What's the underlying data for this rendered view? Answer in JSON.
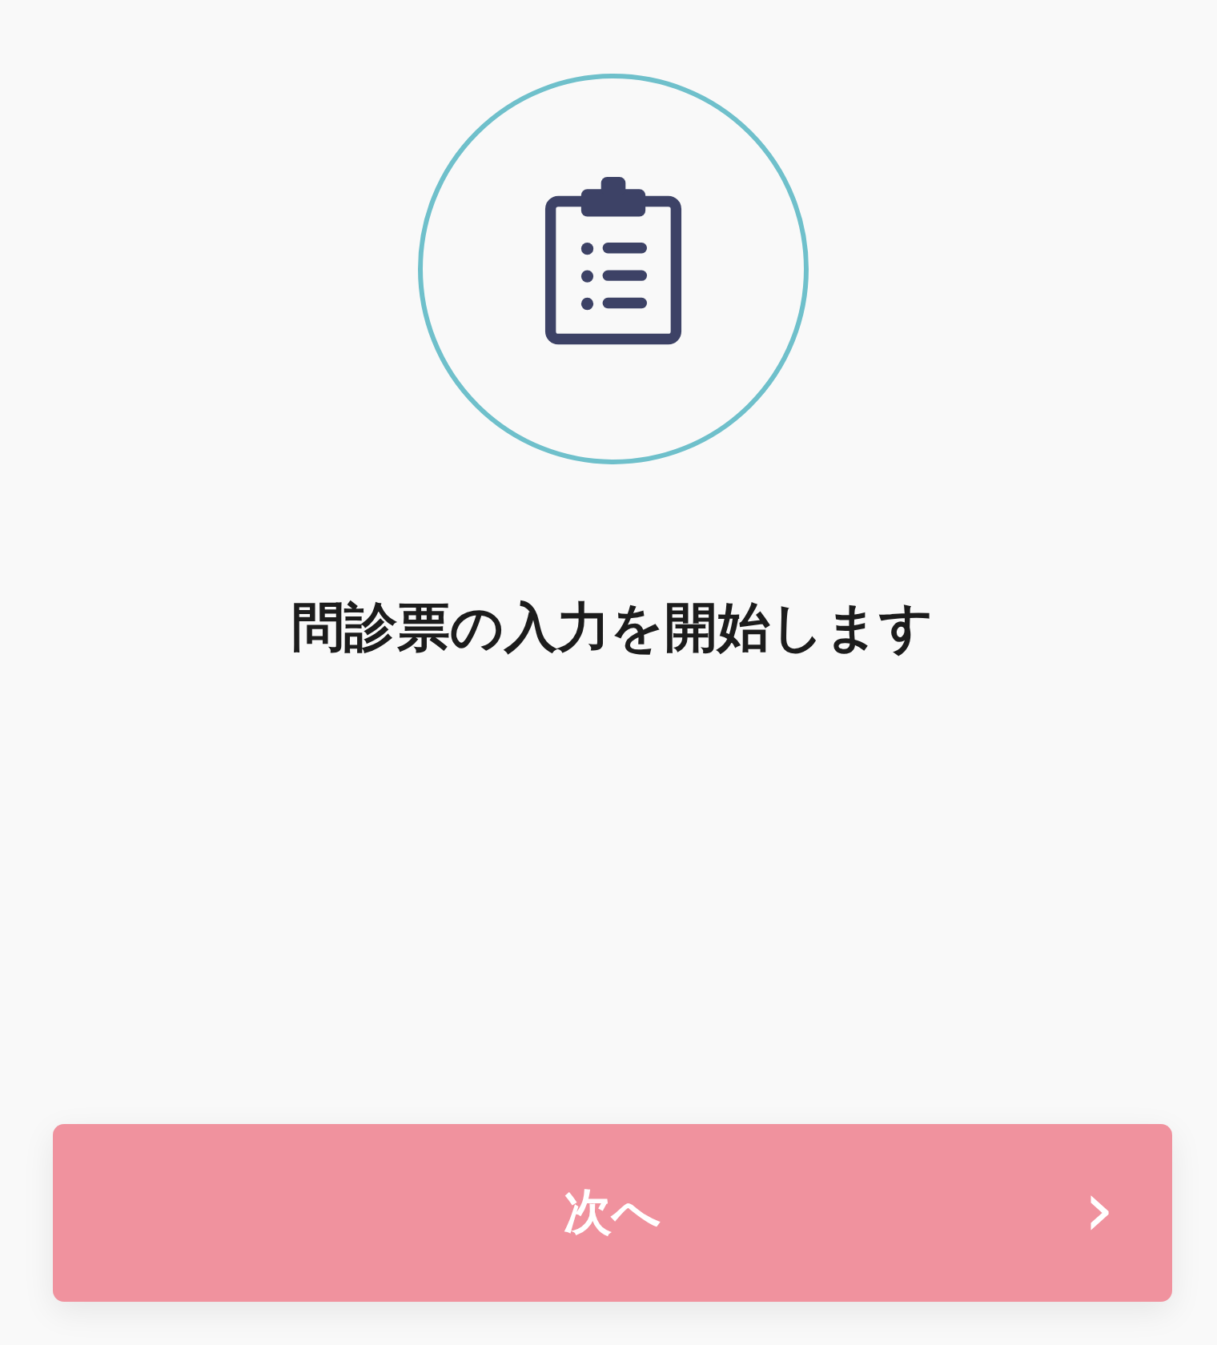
{
  "title": "問診票の入力を開始します",
  "next_button": {
    "label": "次へ",
    "chevron": "›"
  }
}
